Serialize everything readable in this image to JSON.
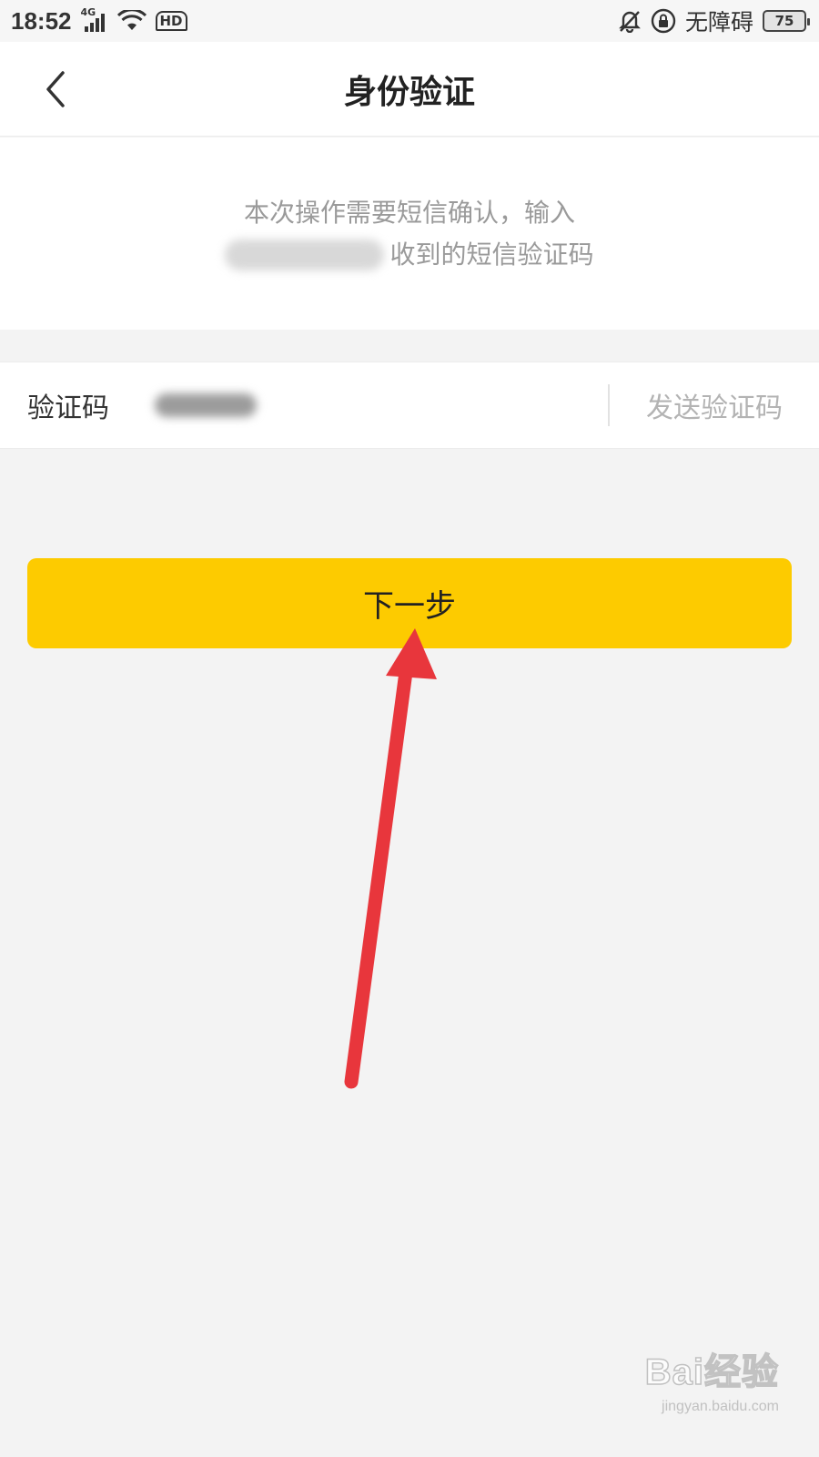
{
  "status_bar": {
    "time": "18:52",
    "network_type": "4G",
    "hd_label": "HD",
    "accessibility_label": "无障碍",
    "battery_level": "75",
    "icons": [
      "signal-icon",
      "wifi-icon",
      "hd-voice-icon",
      "bell-muted-icon",
      "rotation-lock-icon",
      "battery-icon"
    ]
  },
  "header": {
    "back_icon": "chevron-left-icon",
    "title": "身份验证"
  },
  "description": {
    "line1": "本次操作需要短信确认，输入",
    "line2_suffix": "收到的短信验证码"
  },
  "verification": {
    "label": "验证码",
    "send_code_label": "发送验证码"
  },
  "next_button": {
    "label": "下一步"
  },
  "watermark": {
    "logo": "Bai经验",
    "url": "jingyan.baidu.com"
  },
  "colors": {
    "accent": "#fdcb00",
    "annotation_arrow": "#e8363c",
    "background": "#f3f3f3"
  }
}
